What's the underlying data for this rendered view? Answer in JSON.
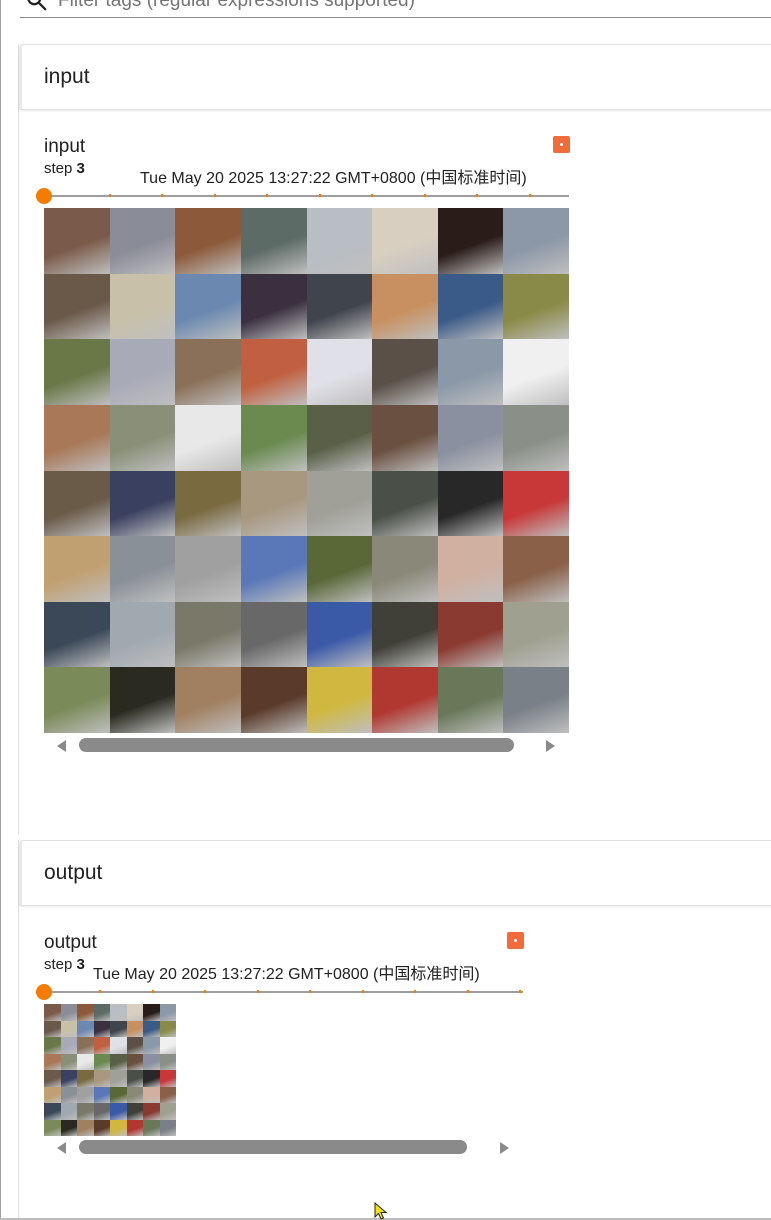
{
  "filter": {
    "placeholder": "Filter tags (regular expressions supported)",
    "icon": "search-icon"
  },
  "panes": [
    {
      "title": "input",
      "card": {
        "tag": "input",
        "step_label": "step",
        "step_value": "3",
        "timestamp": "Tue May 20 2025 13:27:22 GMT+0800 (中国标准时间)",
        "badge_color": "#f26b3a",
        "slider_color": "#f57c00"
      }
    },
    {
      "title": "output",
      "card": {
        "tag": "output",
        "step_label": "step",
        "step_value": "3",
        "timestamp": "Tue May 20 2025 13:27:22 GMT+0800 (中国标准时间)",
        "badge_color": "#f26b3a",
        "slider_color": "#f57c00"
      }
    }
  ],
  "image_grid_palette": [
    "#7a5a48",
    "#8a8c98",
    "#8c5a3a",
    "#5c6b66",
    "#b8bec4",
    "#d8cfc0",
    "#2a1c18",
    "#8c98a8",
    "#6a5848",
    "#c8c0a8",
    "#6a88b0",
    "#3a3040",
    "#40444c",
    "#c89060",
    "#3a5a88",
    "#8a8a48",
    "#6a7848",
    "#a8aab8",
    "#8a7058",
    "#c06040",
    "#e0e0e8",
    "#5a5048",
    "#8a98a8",
    "#f0f0f0",
    "#a87858",
    "#8a9078",
    "#e8e8e8",
    "#6a8a50",
    "#5a6048",
    "#6a5040",
    "#8a90a0",
    "#8a9088",
    "#6a5a48",
    "#3a4060",
    "#7a6a40",
    "#a89880",
    "#a0a098",
    "#4a5048",
    "#282828",
    "#c83838",
    "#c0a070",
    "#8a9098",
    "#a0a0a0",
    "#5a78b8",
    "#5a6838",
    "#8a8878",
    "#d0b0a0",
    "#8a6048",
    "#3a4858",
    "#a0a8b0",
    "#7a7868",
    "#686868",
    "#3a5aa8",
    "#404038",
    "#8a3a30",
    "#a0a090",
    "#7a8a58",
    "#2a2a20",
    "#a08060",
    "#5a3a28",
    "#d0b840",
    "#b03830",
    "#687858",
    "#7a8088"
  ]
}
